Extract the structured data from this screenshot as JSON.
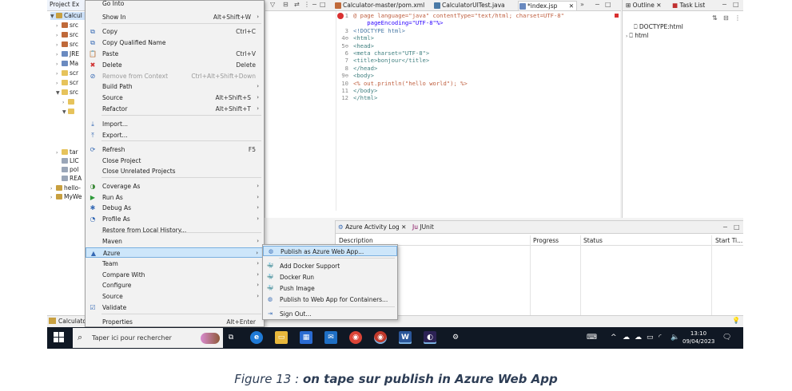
{
  "project_explorer": {
    "tab_label": "Project Ex",
    "rows": [
      {
        "label": "Calcul",
        "expanded": true
      },
      {
        "label": "src"
      },
      {
        "label": "src"
      },
      {
        "label": "src"
      },
      {
        "label": "JRE"
      },
      {
        "label": "Ma"
      },
      {
        "label": "scr"
      },
      {
        "label": "scr"
      },
      {
        "label": "src",
        "expanded": true
      },
      {
        "label": "tar"
      },
      {
        "label": "LIC"
      },
      {
        "label": "pol"
      },
      {
        "label": "REA"
      },
      {
        "label": "hello-"
      },
      {
        "label": "MyWe"
      }
    ],
    "status_label": "Calculato"
  },
  "context_menu": {
    "items": [
      {
        "label": "Go Into",
        "shortcut": ""
      },
      {
        "label": "Show In",
        "shortcut": "Alt+Shift+W",
        "submenu": true
      },
      {
        "label": "Copy",
        "shortcut": "Ctrl+C",
        "icon": "copy-icon"
      },
      {
        "label": "Copy Qualified Name",
        "shortcut": "",
        "icon": "copy-qualified-icon"
      },
      {
        "label": "Paste",
        "shortcut": "Ctrl+V",
        "icon": "paste-icon"
      },
      {
        "label": "Delete",
        "shortcut": "Delete",
        "icon": "delete-icon"
      },
      {
        "label": "Remove from Context",
        "shortcut": "Ctrl+Alt+Shift+Down",
        "icon": "remove-context-icon",
        "disabled": true
      },
      {
        "label": "Build Path",
        "shortcut": "",
        "submenu": true
      },
      {
        "label": "Source",
        "shortcut": "Alt+Shift+S",
        "submenu": true
      },
      {
        "label": "Refactor",
        "shortcut": "Alt+Shift+T",
        "submenu": true
      },
      {
        "label": "Import...",
        "shortcut": "",
        "icon": "import-icon"
      },
      {
        "label": "Export...",
        "shortcut": "",
        "icon": "export-icon"
      },
      {
        "label": "Refresh",
        "shortcut": "F5",
        "icon": "refresh-icon"
      },
      {
        "label": "Close Project",
        "shortcut": ""
      },
      {
        "label": "Close Unrelated Projects",
        "shortcut": ""
      },
      {
        "label": "Coverage As",
        "shortcut": "",
        "submenu": true,
        "icon": "coverage-icon"
      },
      {
        "label": "Run As",
        "shortcut": "",
        "submenu": true,
        "icon": "run-icon"
      },
      {
        "label": "Debug As",
        "shortcut": "",
        "submenu": true,
        "icon": "debug-icon"
      },
      {
        "label": "Profile As",
        "shortcut": "",
        "submenu": true,
        "icon": "profile-icon"
      },
      {
        "label": "Restore from Local History...",
        "shortcut": ""
      },
      {
        "label": "Maven",
        "shortcut": "",
        "submenu": true
      },
      {
        "label": "Azure",
        "shortcut": "",
        "submenu": true,
        "icon": "azure-icon",
        "highlighted": true
      },
      {
        "label": "Team",
        "shortcut": "",
        "submenu": true
      },
      {
        "label": "Compare With",
        "shortcut": "",
        "submenu": true
      },
      {
        "label": "Configure",
        "shortcut": "",
        "submenu": true
      },
      {
        "label": "Source",
        "shortcut": "",
        "submenu": true
      },
      {
        "label": "Validate",
        "shortcut": "",
        "icon": "validate-icon"
      },
      {
        "label": "Properties",
        "shortcut": "Alt+Enter"
      }
    ]
  },
  "azure_submenu": {
    "items": [
      {
        "label": "Publish as Azure Web App...",
        "icon": "azure-webapp-icon",
        "highlighted": true
      },
      {
        "label": "Add Docker Support",
        "icon": "docker-icon"
      },
      {
        "label": "Docker Run",
        "icon": "docker-run-icon"
      },
      {
        "label": "Push Image",
        "icon": "push-image-icon"
      },
      {
        "label": "Publish to Web App for Containers...",
        "icon": "container-webapp-icon"
      },
      {
        "label": "Sign Out...",
        "icon": "sign-out-icon"
      }
    ]
  },
  "editor": {
    "tabs": [
      {
        "label": "Calculator-master/pom.xml",
        "active": false
      },
      {
        "label": "CalculatorUITest.java",
        "active": false
      },
      {
        "label": "*index.jsp",
        "active": true
      }
    ],
    "code_lines": [
      {
        "num": "1",
        "text": "@ page language=\"java\" contentType=\"text/html; charset=UTF-8\""
      },
      {
        "num": "",
        "text": "    pageEncoding=\"UTF-8\"%>"
      },
      {
        "num": "3",
        "text": "<!DOCTYPE html>"
      },
      {
        "num": "4⊖",
        "text": "<html>"
      },
      {
        "num": "5⊖",
        "text": "<head>"
      },
      {
        "num": "6",
        "text": "<meta charset=\"UTF-8\">"
      },
      {
        "num": "7",
        "text": "<title>bonjour</title>"
      },
      {
        "num": "8",
        "text": "</head>"
      },
      {
        "num": "9⊖",
        "text": "<body>"
      },
      {
        "num": "10",
        "text": "<% out.println(\"hello world\"); %>"
      },
      {
        "num": "11",
        "text": "</body>"
      },
      {
        "num": "12",
        "text": "</html>"
      }
    ]
  },
  "outline": {
    "tab_outline": "Outline",
    "tab_tasklist": "Task List",
    "rows": [
      {
        "label": "DOCTYPE:html"
      },
      {
        "label": "html"
      }
    ]
  },
  "bottom_panel": {
    "tab_activity": "Azure Activity Log",
    "tab_junit": "JUnit",
    "columns": [
      "Description",
      "Progress",
      "Status",
      "Start Ti..."
    ]
  },
  "taskbar": {
    "search_placeholder": "Taper ici pour rechercher",
    "time": "13:10",
    "date": "09/04/2023"
  },
  "caption": {
    "prefix": "Figure 13 : ",
    "text": "on tape sur publish in Azure Web App"
  },
  "colors": {
    "accent": "#3569b4",
    "highlight": "#cde6fa",
    "taskbar": "#101824",
    "caption": "#2d3d55"
  }
}
